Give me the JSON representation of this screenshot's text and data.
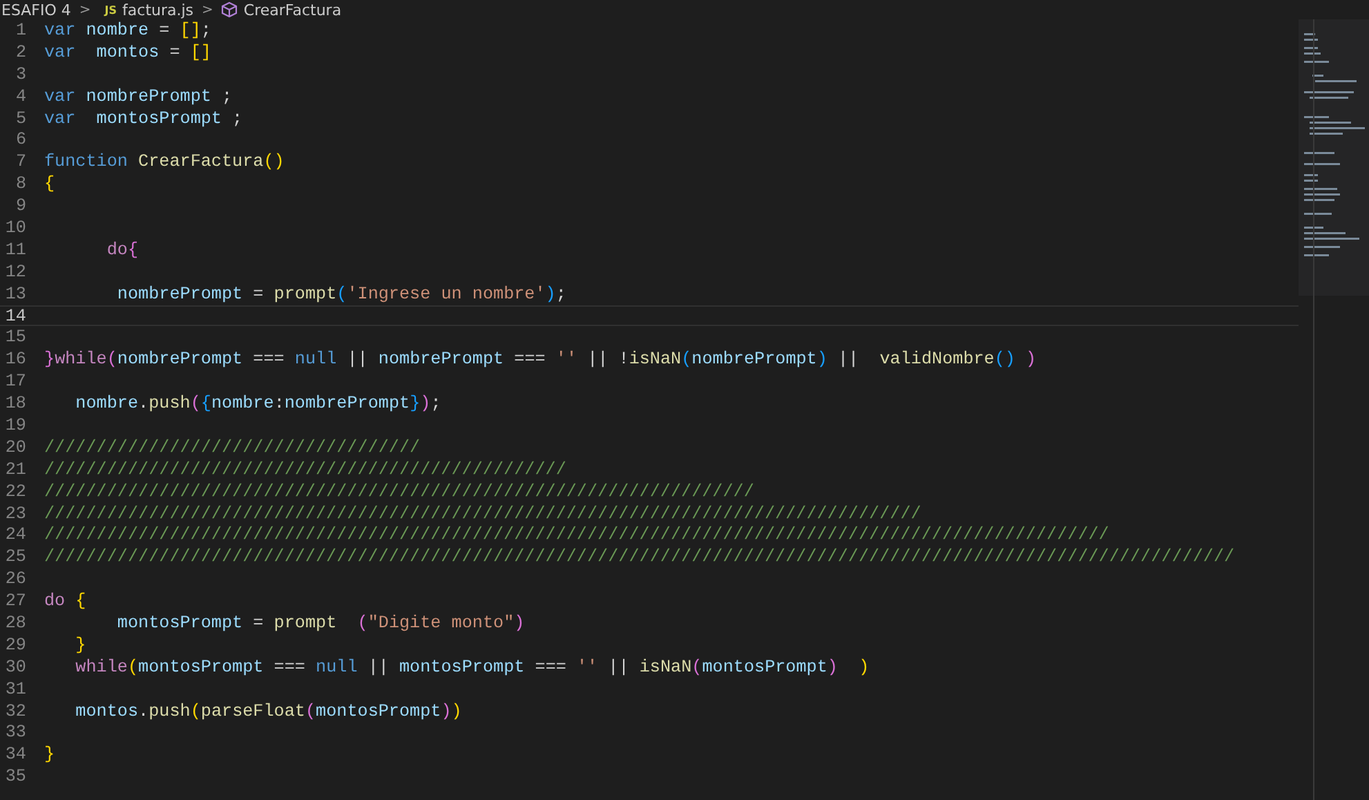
{
  "breadcrumb": {
    "folder": "ESAFIO 4",
    "separator_1": ">",
    "file_badge": "JS",
    "file": "factura.js",
    "separator_2": ">",
    "symbol": "CrearFactura"
  },
  "lines": [
    {
      "number": "1",
      "current": false,
      "tokens": [
        {
          "kind": "keyword",
          "text": "var"
        },
        {
          "kind": "variable",
          "text": " nombre"
        },
        {
          "kind": "plain",
          "text": " = "
        },
        {
          "kind": "bracket1",
          "text": "[]"
        },
        {
          "kind": "plain",
          "text": ";"
        }
      ]
    },
    {
      "number": "2",
      "current": false,
      "tokens": [
        {
          "kind": "keyword",
          "text": "var"
        },
        {
          "kind": "variable",
          "text": "  montos"
        },
        {
          "kind": "plain",
          "text": " = "
        },
        {
          "kind": "bracket1",
          "text": "[]"
        }
      ]
    },
    {
      "number": "3",
      "current": false
    },
    {
      "number": "4",
      "current": false,
      "tokens": [
        {
          "kind": "keyword",
          "text": "var"
        },
        {
          "kind": "variable",
          "text": " nombrePrompt"
        },
        {
          "kind": "plain",
          "text": " ;"
        }
      ]
    },
    {
      "number": "5",
      "current": false,
      "tokens": [
        {
          "kind": "keyword",
          "text": "var"
        },
        {
          "kind": "variable",
          "text": "  montosPrompt"
        },
        {
          "kind": "plain",
          "text": " ;"
        }
      ]
    },
    {
      "number": "6",
      "current": false
    },
    {
      "number": "7",
      "current": false,
      "tokens": [
        {
          "kind": "keyword",
          "text": "function"
        },
        {
          "kind": "function",
          "text": " CrearFactura"
        },
        {
          "kind": "bracket1",
          "text": "()"
        }
      ]
    },
    {
      "number": "8",
      "current": false,
      "tokens": [
        {
          "kind": "bracket1",
          "text": "{"
        }
      ]
    },
    {
      "number": "9",
      "current": false
    },
    {
      "number": "10",
      "current": false
    },
    {
      "number": "11",
      "current": false,
      "tokens": [
        {
          "kind": "control",
          "text": "      do"
        },
        {
          "kind": "bracket2",
          "text": "{"
        }
      ]
    },
    {
      "number": "12",
      "current": false
    },
    {
      "number": "13",
      "current": false,
      "tokens": [
        {
          "kind": "variable",
          "text": "       nombrePrompt"
        },
        {
          "kind": "plain",
          "text": " = "
        },
        {
          "kind": "function",
          "text": "prompt"
        },
        {
          "kind": "bracket3",
          "text": "("
        },
        {
          "kind": "string",
          "text": "'Ingrese un nombre'"
        },
        {
          "kind": "bracket3",
          "text": ")"
        },
        {
          "kind": "plain",
          "text": ";"
        }
      ]
    },
    {
      "number": "14",
      "current": true
    },
    {
      "number": "15",
      "current": false
    },
    {
      "number": "16",
      "current": false,
      "tokens": [
        {
          "kind": "bracket2",
          "text": "}"
        },
        {
          "kind": "control",
          "text": "while"
        },
        {
          "kind": "bracket2",
          "text": "("
        },
        {
          "kind": "variable",
          "text": "nombrePrompt"
        },
        {
          "kind": "plain",
          "text": " === "
        },
        {
          "kind": "keyword",
          "text": "null"
        },
        {
          "kind": "plain",
          "text": " || "
        },
        {
          "kind": "variable",
          "text": "nombrePrompt"
        },
        {
          "kind": "plain",
          "text": " === "
        },
        {
          "kind": "string",
          "text": "''"
        },
        {
          "kind": "plain",
          "text": " || !"
        },
        {
          "kind": "function",
          "text": "isNaN"
        },
        {
          "kind": "bracket3",
          "text": "("
        },
        {
          "kind": "variable",
          "text": "nombrePrompt"
        },
        {
          "kind": "bracket3",
          "text": ")"
        },
        {
          "kind": "plain",
          "text": " ||  "
        },
        {
          "kind": "function",
          "text": "validNombre"
        },
        {
          "kind": "bracket3",
          "text": "()"
        },
        {
          "kind": "bracket2",
          "text": " )"
        }
      ]
    },
    {
      "number": "17",
      "current": false
    },
    {
      "number": "18",
      "current": false,
      "tokens": [
        {
          "kind": "variable",
          "text": "   nombre"
        },
        {
          "kind": "plain",
          "text": "."
        },
        {
          "kind": "function",
          "text": "push"
        },
        {
          "kind": "bracket2",
          "text": "("
        },
        {
          "kind": "bracket3",
          "text": "{"
        },
        {
          "kind": "variable",
          "text": "nombre"
        },
        {
          "kind": "plain",
          "text": ":"
        },
        {
          "kind": "variable",
          "text": "nombrePrompt"
        },
        {
          "kind": "bracket3",
          "text": "}"
        },
        {
          "kind": "bracket2",
          "text": ")"
        },
        {
          "kind": "plain",
          "text": ";"
        }
      ]
    },
    {
      "number": "19",
      "current": false
    },
    {
      "number": "20",
      "current": false,
      "tokens": [
        {
          "kind": "comment",
          "text": "////////////////////////////////////"
        }
      ]
    },
    {
      "number": "21",
      "current": false,
      "tokens": [
        {
          "kind": "comment",
          "text": "//////////////////////////////////////////////////"
        }
      ]
    },
    {
      "number": "22",
      "current": false,
      "tokens": [
        {
          "kind": "comment",
          "text": "////////////////////////////////////////////////////////////////////"
        }
      ]
    },
    {
      "number": "23",
      "current": false,
      "tokens": [
        {
          "kind": "comment",
          "text": "////////////////////////////////////////////////////////////////////////////////////"
        }
      ]
    },
    {
      "number": "24",
      "current": false,
      "tokens": [
        {
          "kind": "comment",
          "text": "//////////////////////////////////////////////////////////////////////////////////////////////////////"
        }
      ]
    },
    {
      "number": "25",
      "current": false,
      "tokens": [
        {
          "kind": "comment",
          "text": "//////////////////////////////////////////////////////////////////////////////////////////////////////////////////"
        }
      ]
    },
    {
      "number": "26",
      "current": false
    },
    {
      "number": "27",
      "current": false,
      "tokens": [
        {
          "kind": "control",
          "text": "do"
        },
        {
          "kind": "bracket1",
          "text": " {"
        }
      ]
    },
    {
      "number": "28",
      "current": false,
      "tokens": [
        {
          "kind": "variable",
          "text": "       montosPrompt"
        },
        {
          "kind": "plain",
          "text": " = "
        },
        {
          "kind": "function",
          "text": "prompt"
        },
        {
          "kind": "bracket2",
          "text": "  ("
        },
        {
          "kind": "string",
          "text": "\"Digite monto\""
        },
        {
          "kind": "bracket2",
          "text": ")"
        }
      ]
    },
    {
      "number": "29",
      "current": false,
      "tokens": [
        {
          "kind": "bracket1",
          "text": "   }"
        }
      ]
    },
    {
      "number": "30",
      "current": false,
      "tokens": [
        {
          "kind": "control",
          "text": "   while"
        },
        {
          "kind": "bracket1",
          "text": "("
        },
        {
          "kind": "variable",
          "text": "montosPrompt"
        },
        {
          "kind": "plain",
          "text": " === "
        },
        {
          "kind": "keyword",
          "text": "null"
        },
        {
          "kind": "plain",
          "text": " || "
        },
        {
          "kind": "variable",
          "text": "montosPrompt"
        },
        {
          "kind": "plain",
          "text": " === "
        },
        {
          "kind": "string",
          "text": "''"
        },
        {
          "kind": "plain",
          "text": " || "
        },
        {
          "kind": "function",
          "text": "isNaN"
        },
        {
          "kind": "bracket2",
          "text": "("
        },
        {
          "kind": "variable",
          "text": "montosPrompt"
        },
        {
          "kind": "bracket2",
          "text": ")"
        },
        {
          "kind": "bracket1",
          "text": "  )"
        }
      ]
    },
    {
      "number": "31",
      "current": false
    },
    {
      "number": "32",
      "current": false,
      "tokens": [
        {
          "kind": "variable",
          "text": "   montos"
        },
        {
          "kind": "plain",
          "text": "."
        },
        {
          "kind": "function",
          "text": "push"
        },
        {
          "kind": "bracket1",
          "text": "("
        },
        {
          "kind": "function",
          "text": "parseFloat"
        },
        {
          "kind": "bracket2",
          "text": "("
        },
        {
          "kind": "variable",
          "text": "montosPrompt"
        },
        {
          "kind": "bracket2",
          "text": ")"
        },
        {
          "kind": "bracket1",
          "text": ")"
        }
      ]
    },
    {
      "number": "33",
      "current": false
    },
    {
      "number": "34",
      "current": false,
      "tokens": [
        {
          "kind": "bracket1",
          "text": "}"
        }
      ]
    },
    {
      "number": "35",
      "current": false
    }
  ]
}
